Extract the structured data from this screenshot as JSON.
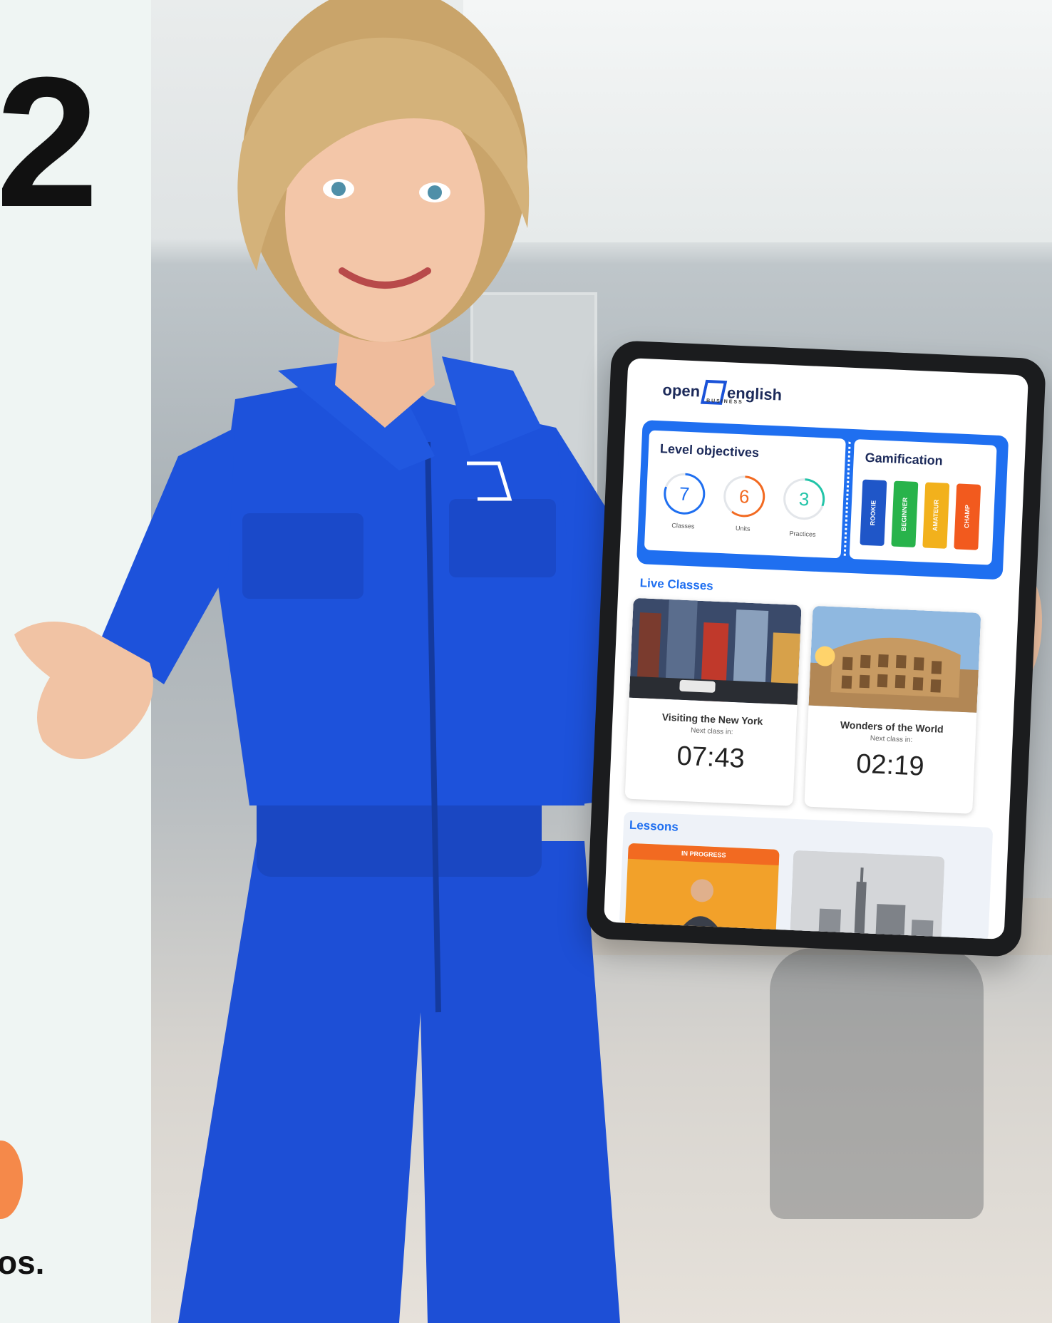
{
  "hero": {
    "big_number": "2",
    "tail_text": "os."
  },
  "tablet": {
    "logo": {
      "open": "open",
      "english": "english",
      "sub": "BUSINESS"
    },
    "level_objectives": {
      "title": "Level objectives",
      "items": [
        {
          "value": "7",
          "label": "Classes",
          "color": "#1f6ff0",
          "progress": 0.8
        },
        {
          "value": "6",
          "label": "Units",
          "color": "#f26a21",
          "progress": 0.6
        },
        {
          "value": "3",
          "label": "Practices",
          "color": "#22c4a8",
          "progress": 0.3
        }
      ]
    },
    "gamification": {
      "title": "Gamification",
      "badges": [
        {
          "label": "ROOKIE",
          "color": "#1f56c8"
        },
        {
          "label": "BEGINNER",
          "color": "#28b34b"
        },
        {
          "label": "AMATEUR",
          "color": "#f2b11c"
        },
        {
          "label": "CHAMP",
          "color": "#f25a1e"
        }
      ]
    },
    "live_classes": {
      "title": "Live Classes",
      "cards": [
        {
          "title": "Visiting the New York",
          "subtitle": "Next class in:",
          "time": "07:43"
        },
        {
          "title": "Wonders of the World",
          "subtitle": "Next class in:",
          "time": "02:19"
        }
      ]
    },
    "lessons": {
      "title": "Lessons",
      "cards": [
        {
          "tag": "IN PROGRESS"
        }
      ]
    }
  },
  "colors": {
    "brand_blue": "#1f6ff0",
    "suit_blue": "#1d4fd6",
    "accent_orange": "#f5894a"
  }
}
